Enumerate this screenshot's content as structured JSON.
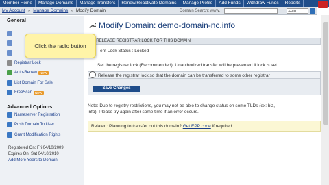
{
  "topnav": {
    "items": [
      "Member Home",
      "Manage Domains",
      "Manage Transfers",
      "Renew/Reactivate Domains",
      "Manage Profile",
      "Add Funds",
      "Withdraw Funds",
      "Reports"
    ]
  },
  "breadcrumb": {
    "items": [
      "My Account",
      "Manage Domains",
      "Modify Domain"
    ],
    "separator": "»"
  },
  "search": {
    "label": "Domain Search: www.",
    "tld": ".com"
  },
  "sidebar": {
    "general_title": "General",
    "items": [
      {
        "label": "Registrar Lock",
        "icon": "lock-icon"
      },
      {
        "label": "Auto-Renew",
        "icon": "refresh-icon",
        "badge": "NEW"
      },
      {
        "label": "List Domain For Sale",
        "icon": "sale-icon"
      },
      {
        "label": "FreeScan",
        "icon": "scan-icon",
        "badge": "NEW"
      }
    ],
    "advanced_title": "Advanced Options",
    "advanced_items": [
      {
        "label": "Nameserver Registration",
        "icon": "server-icon"
      },
      {
        "label": "Push Domain To User",
        "icon": "push-icon"
      },
      {
        "label": "Grant Modification Rights",
        "icon": "rights-icon"
      }
    ],
    "registered_on": "Registered On: Fri 04/10/2009",
    "expires_on": "Expires On: Sat 04/10/2010",
    "add_years_link": "Add More Years to Domain"
  },
  "tooltip": {
    "text": "Click the radio button"
  },
  "main": {
    "title": "Modify Domain:",
    "domain": "demo-domain-nc.info",
    "panel_header": "/ RELEASE REGISTRAR LOCK FOR THIS DOMAIN",
    "lock_status": "ent Lock Status : Locked",
    "option1": "Set the registrar lock (Recommended). Unauthorized transfer will be prevented if lock is set.",
    "option2": "Release the registrar lock so that the domain can be transferred to some other registrar",
    "save_label": "Save Changes",
    "note_line1": "Note: Due to registry restrictions, you may not be able to change status on some TLDs (ex: biz,",
    "note_line2": "info). Please try again after some time if an error occurs.",
    "related_prefix": "Related: Planning to transfer out this domain?",
    "related_link": "Get EPP code",
    "related_suffix": "if required."
  }
}
